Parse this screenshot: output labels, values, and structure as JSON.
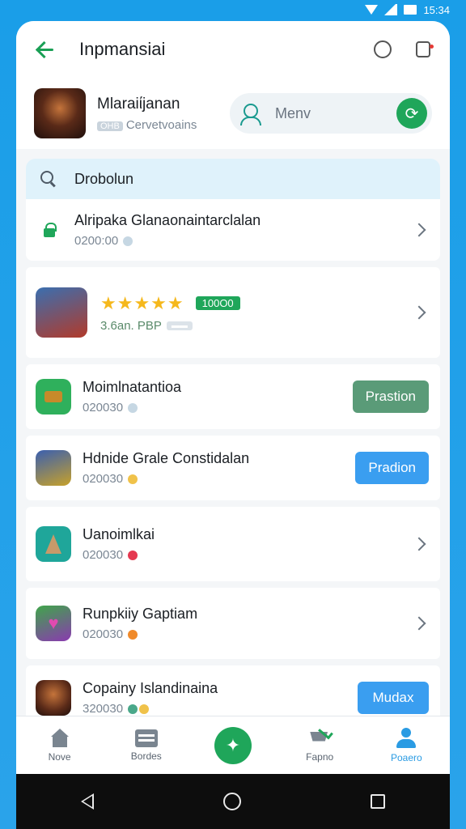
{
  "status_bar": {
    "time": "15:34"
  },
  "topbar": {
    "title": "Inpmansiai"
  },
  "header": {
    "game_name": "Mlaraiίjanan",
    "game_tag": "OHB",
    "game_sub": "Cervetvoains",
    "menu_label": "Menv"
  },
  "search": {
    "label": "Drobolun"
  },
  "rows": [
    {
      "title": "Alripaka Glanaonaintarclalan",
      "sub": "0200:00"
    },
    {
      "rating_badge": "100O0",
      "sub": "3.6an. PBP"
    },
    {
      "title": "Moimlnatantioa",
      "sub": "020030",
      "action": "Prastion"
    },
    {
      "title": "Hdnide Grale Constidalan",
      "sub": "020030",
      "action": "Pradion"
    },
    {
      "title": "Uanoimlkai",
      "sub": "020030"
    },
    {
      "title": "Runpkiiy Gaptiam",
      "sub": "020030"
    },
    {
      "title": "Copainy Islandinaina",
      "sub": "320030",
      "action": "Mudax"
    }
  ],
  "bottom_nav": [
    {
      "label": "Nove"
    },
    {
      "label": "Bordes"
    },
    {
      "label": ""
    },
    {
      "label": "Fapno"
    },
    {
      "label": "Poaero"
    }
  ],
  "colors": {
    "brand_green": "#1fa65a",
    "btn_green_muted": "#5a9b78",
    "btn_blue": "#3a9ef0",
    "accent_blue": "#2a9be3"
  }
}
